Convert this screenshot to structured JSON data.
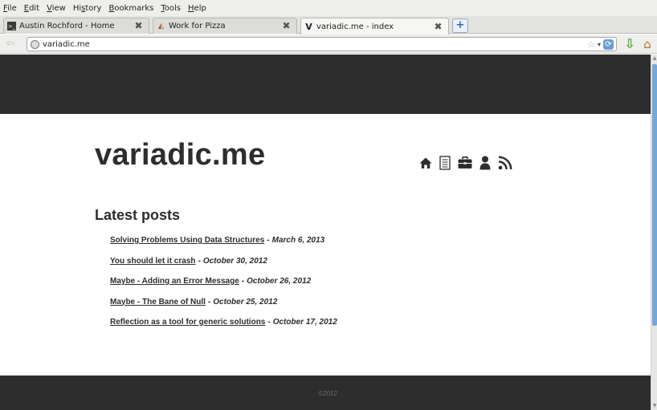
{
  "menubar": {
    "items": [
      {
        "key": "F",
        "rest": "ile"
      },
      {
        "key": "E",
        "rest": "dit"
      },
      {
        "key": "V",
        "rest": "iew"
      },
      {
        "pre": "Hi",
        "key": "s",
        "rest": "tory"
      },
      {
        "key": "B",
        "rest": "ookmarks"
      },
      {
        "key": "T",
        "rest": "ools"
      },
      {
        "key": "H",
        "rest": "elp"
      }
    ]
  },
  "tabs": [
    {
      "title": "Austin Rochford - Home",
      "favicon": "terminal-icon",
      "active": false
    },
    {
      "title": "Work for Pizza",
      "favicon": "pizza-icon",
      "active": false
    },
    {
      "title": "variadic.me - index",
      "favicon": "v-icon",
      "favicon_text": "V",
      "active": true
    }
  ],
  "new_tab_label": "+",
  "navbar": {
    "url": "variadic.me",
    "back_glyph": "⇦",
    "star_glyph": "☆",
    "dropdown_glyph": "▾",
    "reload_glyph": "⟳",
    "download_glyph": "⇩",
    "home_glyph": "⌂"
  },
  "site": {
    "title": "variadic.me",
    "nav_icons": [
      "home-icon",
      "document-icon",
      "briefcase-icon",
      "person-icon",
      "rss-icon"
    ],
    "section_title": "Latest posts",
    "posts": [
      {
        "title": "Solving Problems Using Data Structures",
        "date": "March 6, 2013"
      },
      {
        "title": "You should let it crash",
        "date": "October 30, 2012"
      },
      {
        "title": "Maybe - Adding an Error Message",
        "date": "October 26, 2012"
      },
      {
        "title": "Maybe - The Bane of Null",
        "date": "October 25, 2012"
      },
      {
        "title": "Reflection as a tool for generic solutions",
        "date": "October 17, 2012"
      }
    ],
    "post_separator": "-",
    "copyright": "©2012"
  },
  "colors": {
    "band": "#2d2d2d",
    "scroll_thumb": "#76a5d8"
  }
}
